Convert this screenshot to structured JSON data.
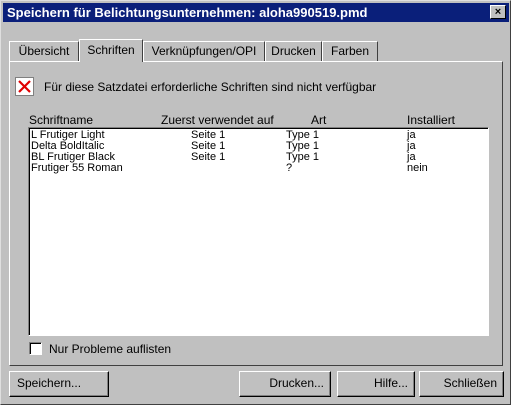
{
  "window": {
    "title": "Speichern für Belichtungsunternehmen: aloha990519.pmd",
    "close_label": "×"
  },
  "tabs": [
    {
      "label": "Übersicht",
      "active": false
    },
    {
      "label": "Schriften",
      "active": true
    },
    {
      "label": "Verknüpfungen/OPI",
      "active": false
    },
    {
      "label": "Drucken",
      "active": false
    },
    {
      "label": "Farben",
      "active": false
    }
  ],
  "warning": {
    "icon": "red-x-icon",
    "text": "Für diese Satzdatei erforderliche Schriften sind nicht verfügbar"
  },
  "fonts_table": {
    "columns": [
      "Schriftname",
      "Zuerst verwendet auf",
      "Art",
      "Installiert"
    ],
    "rows": [
      {
        "name": "L Frutiger Light",
        "first_used": "Seite 1",
        "type": "Type 1",
        "installed": "ja"
      },
      {
        "name": "Delta BoldItalic",
        "first_used": "Seite 1",
        "type": "Type 1",
        "installed": "ja"
      },
      {
        "name": "BL Frutiger Black",
        "first_used": "Seite 1",
        "type": "Type 1",
        "installed": "ja"
      },
      {
        "name": "Frutiger 55 Roman",
        "first_used": "",
        "type": "?",
        "installed": "nein"
      }
    ]
  },
  "filter": {
    "label": "Nur Probleme auflisten",
    "checked": false
  },
  "buttons": {
    "save": "Speichern...",
    "print": "Drucken...",
    "help": "Hilfe...",
    "close": "Schließen"
  },
  "colors": {
    "title_bar": "#0a1f7a",
    "error_x": "#e00000"
  }
}
